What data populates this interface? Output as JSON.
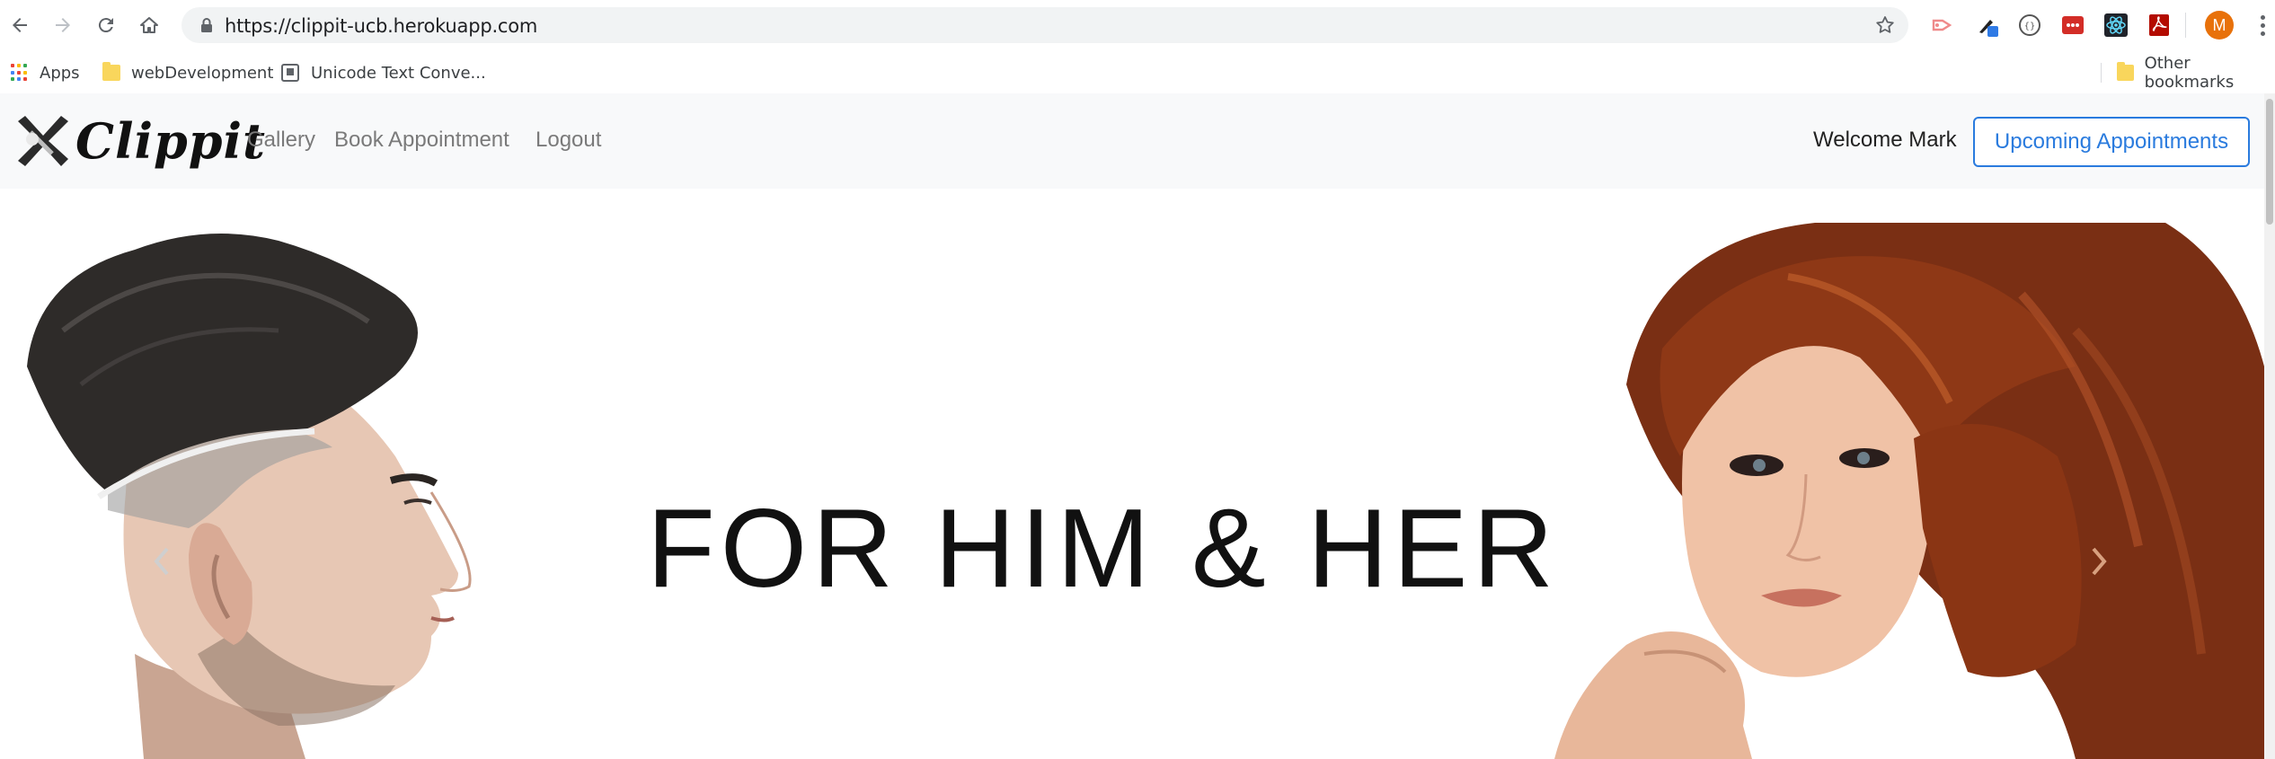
{
  "browser": {
    "url": "https://clippit-ucb.herokuapp.com",
    "profile_initial": "M",
    "bookmarks": [
      {
        "label": "Apps",
        "icon": "apps-grid-icon"
      },
      {
        "label": "webDevelopment",
        "icon": "folder-icon"
      },
      {
        "label": "Unicode Text Conve...",
        "icon": "page-icon"
      }
    ],
    "other_bookmarks": "Other bookmarks"
  },
  "site": {
    "brand": "Clippit",
    "nav_links": [
      "Gallery",
      "Book Appointment",
      "Logout"
    ],
    "welcome": "Welcome Mark",
    "upcoming_button": "Upcoming Appointments",
    "accent_color": "#2a7bde"
  },
  "hero": {
    "headline": "FOR HIM & HER",
    "prev_icon": "chevron-left-icon",
    "next_icon": "chevron-right-icon"
  }
}
